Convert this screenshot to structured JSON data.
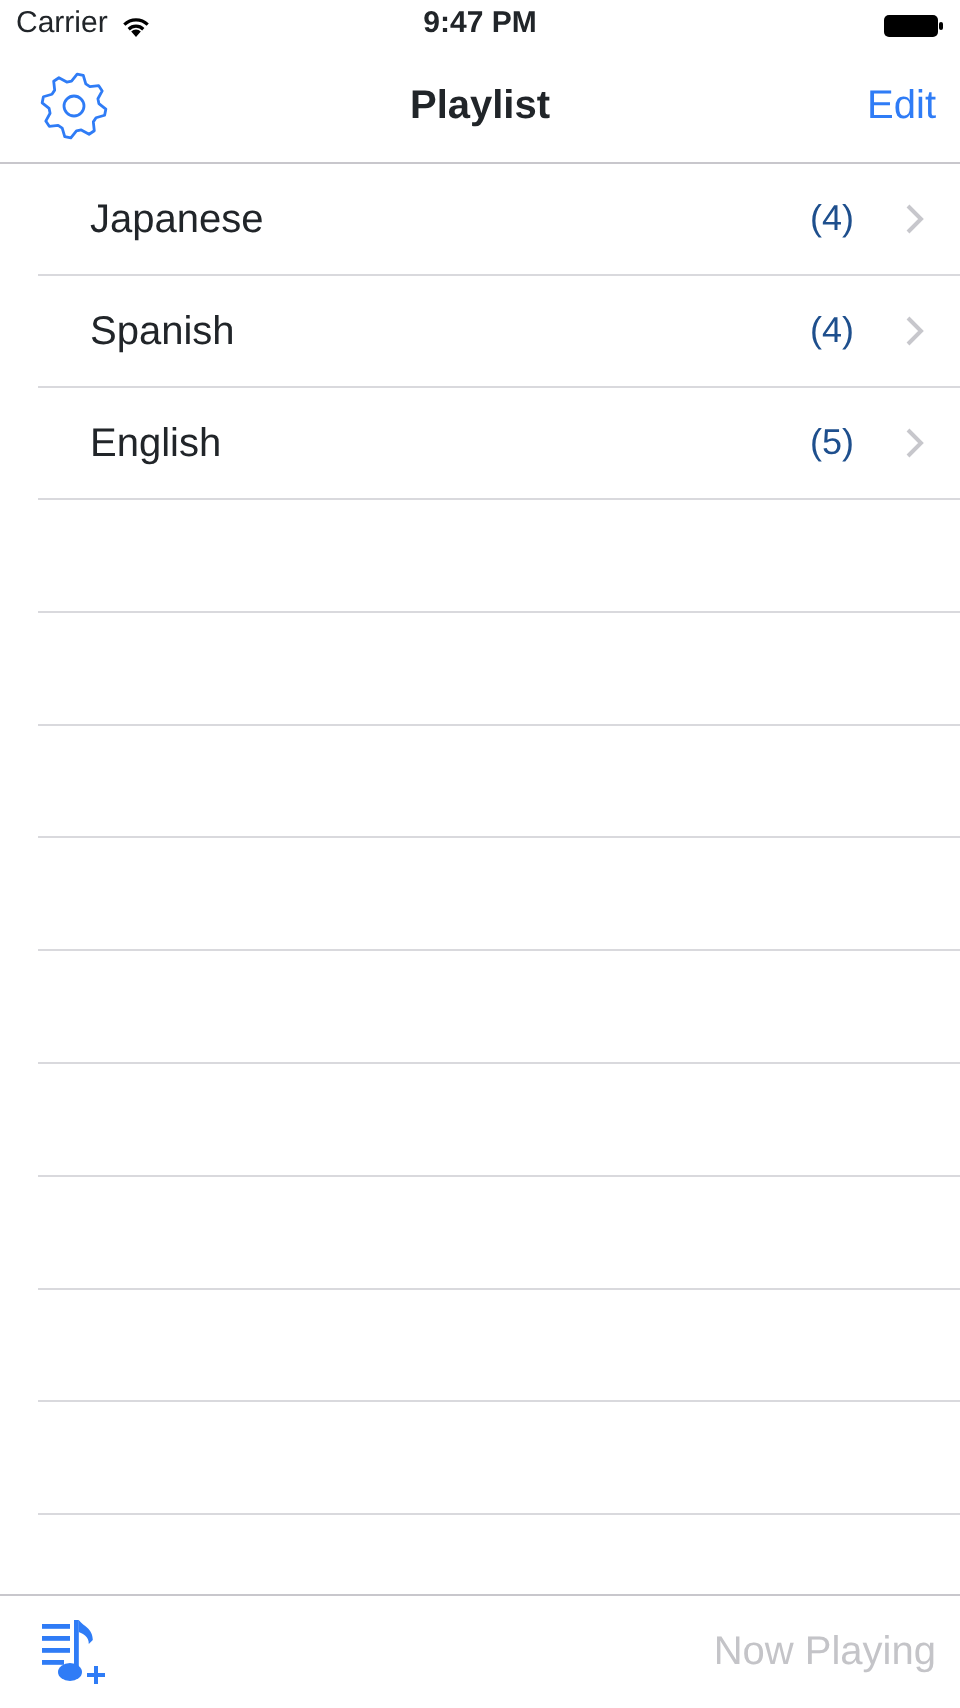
{
  "status_bar": {
    "carrier": "Carrier",
    "time": "9:47 PM"
  },
  "nav_bar": {
    "title": "Playlist",
    "right_button": "Edit"
  },
  "playlists": [
    {
      "name": "Japanese",
      "count": "(4)"
    },
    {
      "name": "Spanish",
      "count": "(4)"
    },
    {
      "name": "English",
      "count": "(5)"
    }
  ],
  "toolbar": {
    "now_playing": {
      "label": "Now Playing",
      "disabled": true
    }
  }
}
